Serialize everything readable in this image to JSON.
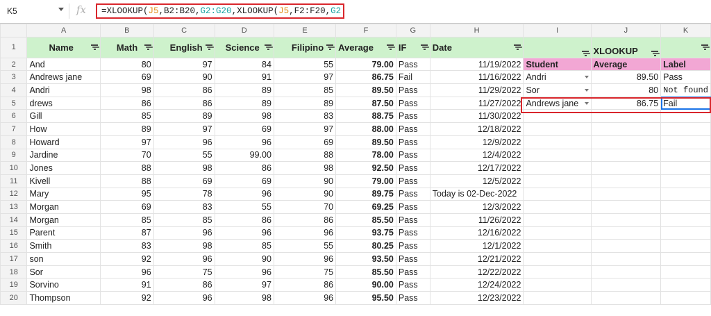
{
  "formula_bar": {
    "cell_ref": "K5",
    "fx": "fx",
    "formula_parts": [
      "=XLOOKUP(",
      "J5",
      ",B2:B20,",
      "G2:G20",
      ",XLOOKUP(",
      "J5",
      ",F2:F20,",
      "G2:G20",
      "))"
    ]
  },
  "columns": [
    "A",
    "B",
    "C",
    "D",
    "E",
    "F",
    "G",
    "H",
    "I",
    "J",
    "K"
  ],
  "headers": {
    "A": "Name",
    "B": "Math",
    "C": "English",
    "D": "Science",
    "E": "Filipino",
    "F": "Average",
    "G": "IF",
    "H": "Date",
    "J": "XLOOKUP"
  },
  "lookup_headers": {
    "student": "Student",
    "average": "Average",
    "label": "Label"
  },
  "rows": [
    {
      "num": "2",
      "name": "And",
      "math": "80",
      "english": "97",
      "science": "84",
      "filipino": "55",
      "average": "79.00",
      "if": "Pass",
      "date": "11/19/2022",
      "i": "",
      "j": "",
      "k": ""
    },
    {
      "num": "3",
      "name": "Andrews jane",
      "math": "69",
      "english": "90",
      "science": "91",
      "filipino": "97",
      "average": "86.75",
      "if": "Fail",
      "date": "11/16/2022",
      "i": "Andri",
      "j": "89.50",
      "k": "Pass"
    },
    {
      "num": "4",
      "name": "Andri",
      "math": "98",
      "english": "86",
      "science": "89",
      "filipino": "85",
      "average": "89.50",
      "if": "Pass",
      "date": "11/29/2022",
      "i": "Sor",
      "j": "80",
      "k": "Not found"
    },
    {
      "num": "5",
      "name": "drews",
      "math": "86",
      "english": "86",
      "science": "89",
      "filipino": "89",
      "average": "87.50",
      "if": "Pass",
      "date": "11/27/2022",
      "i": "Andrews jane",
      "j": "86.75",
      "k": "Fail"
    },
    {
      "num": "6",
      "name": "Gill",
      "math": "85",
      "english": "89",
      "science": "98",
      "filipino": "83",
      "average": "88.75",
      "if": "Pass",
      "date": "11/30/2022",
      "i": "",
      "j": "",
      "k": ""
    },
    {
      "num": "7",
      "name": "How",
      "math": "89",
      "english": "97",
      "science": "69",
      "filipino": "97",
      "average": "88.00",
      "if": "Pass",
      "date": "12/18/2022",
      "i": "",
      "j": "",
      "k": ""
    },
    {
      "num": "8",
      "name": "Howard",
      "math": "97",
      "english": "96",
      "science": "96",
      "filipino": "69",
      "average": "89.50",
      "if": "Pass",
      "date": "12/9/2022",
      "i": "",
      "j": "",
      "k": ""
    },
    {
      "num": "9",
      "name": "Jardine",
      "math": "70",
      "english": "55",
      "science": "99.00",
      "filipino": "88",
      "average": "78.00",
      "if": "Pass",
      "date": "12/4/2022",
      "i": "",
      "j": "",
      "k": ""
    },
    {
      "num": "10",
      "name": "Jones",
      "math": "88",
      "english": "98",
      "science": "86",
      "filipino": "98",
      "average": "92.50",
      "if": "Pass",
      "date": "12/17/2022",
      "i": "",
      "j": "",
      "k": ""
    },
    {
      "num": "11",
      "name": "Kivell",
      "math": "88",
      "english": "69",
      "science": "69",
      "filipino": "90",
      "average": "79.00",
      "if": "Pass",
      "date": "12/5/2022",
      "i": "",
      "j": "",
      "k": ""
    },
    {
      "num": "12",
      "name": "Mary",
      "math": "95",
      "english": "78",
      "science": "96",
      "filipino": "90",
      "average": "89.75",
      "if": "Pass",
      "date": "Today is 02-Dec-2022",
      "i": "",
      "j": "",
      "k": ""
    },
    {
      "num": "13",
      "name": "Morgan",
      "math": "69",
      "english": "83",
      "science": "55",
      "filipino": "70",
      "average": "69.25",
      "if": "Pass",
      "date": "12/3/2022",
      "i": "",
      "j": "",
      "k": ""
    },
    {
      "num": "14",
      "name": "Morgan",
      "math": "85",
      "english": "85",
      "science": "86",
      "filipino": "86",
      "average": "85.50",
      "if": "Pass",
      "date": "11/26/2022",
      "i": "",
      "j": "",
      "k": ""
    },
    {
      "num": "15",
      "name": "Parent",
      "math": "87",
      "english": "96",
      "science": "96",
      "filipino": "96",
      "average": "93.75",
      "if": "Pass",
      "date": "12/16/2022",
      "i": "",
      "j": "",
      "k": ""
    },
    {
      "num": "16",
      "name": "Smith",
      "math": "83",
      "english": "98",
      "science": "85",
      "filipino": "55",
      "average": "80.25",
      "if": "Pass",
      "date": "12/1/2022",
      "i": "",
      "j": "",
      "k": ""
    },
    {
      "num": "17",
      "name": "son",
      "math": "92",
      "english": "96",
      "science": "90",
      "filipino": "96",
      "average": "93.50",
      "if": "Pass",
      "date": "12/21/2022",
      "i": "",
      "j": "",
      "k": ""
    },
    {
      "num": "18",
      "name": "Sor",
      "math": "96",
      "english": "75",
      "science": "96",
      "filipino": "75",
      "average": "85.50",
      "if": "Pass",
      "date": "12/22/2022",
      "i": "",
      "j": "",
      "k": ""
    },
    {
      "num": "19",
      "name": "Sorvino",
      "math": "91",
      "english": "86",
      "science": "97",
      "filipino": "86",
      "average": "90.00",
      "if": "Pass",
      "date": "12/24/2022",
      "i": "",
      "j": "",
      "k": ""
    },
    {
      "num": "20",
      "name": "Thompson",
      "math": "92",
      "english": "96",
      "science": "98",
      "filipino": "96",
      "average": "95.50",
      "if": "Pass",
      "date": "12/23/2022",
      "i": "",
      "j": "",
      "k": ""
    }
  ],
  "colors": {
    "header_green": "#cef2cc",
    "header_pink": "#f2a7d4",
    "highlight_red": "#d9262c",
    "selection_blue": "#1a73e8"
  }
}
